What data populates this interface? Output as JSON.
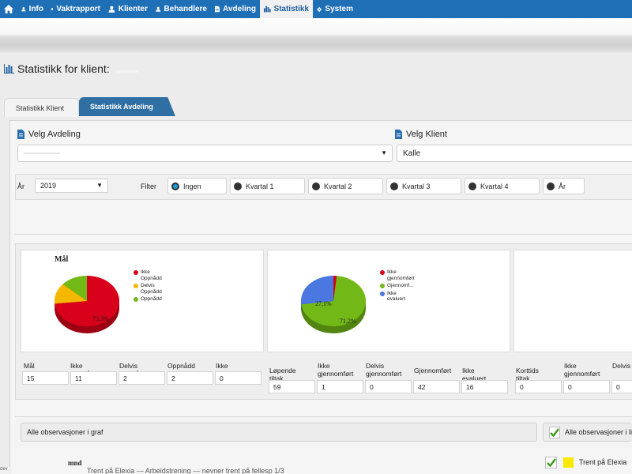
{
  "nav": {
    "items": [
      {
        "label": "Info",
        "icon": "user-icon"
      },
      {
        "label": "Vaktrapport",
        "icon": "document-icon"
      },
      {
        "label": "Klienter",
        "icon": "user-icon"
      },
      {
        "label": "Behandlere",
        "icon": "user-icon"
      },
      {
        "label": "Avdeling",
        "icon": "document-icon"
      },
      {
        "label": "Statistikk",
        "icon": "bar-chart-icon",
        "active": true
      },
      {
        "label": "System",
        "icon": "gear-icon"
      }
    ]
  },
  "page": {
    "title": "Statistikk for klient:"
  },
  "tabs": {
    "klient": "Statistikk Klient",
    "avdeling": "Statistikk Avdeling"
  },
  "selectors": {
    "avdeling_label": "Velg Avdeling",
    "avdeling_value": "",
    "klient_label": "Velg Klient",
    "klient_value": "Kalle"
  },
  "filter": {
    "year_label": "År",
    "year_value": "2019",
    "filter_label": "Filter",
    "options": [
      "Ingen",
      "Kvartal 1",
      "Kvartal 2",
      "Kvartal 3",
      "Kvartal 4",
      "År"
    ],
    "selected": "Ingen"
  },
  "chart_data": [
    {
      "type": "pie",
      "title": "Mål",
      "categories": [
        "Ikke Oppnådd",
        "Delvis Oppnådd",
        "Oppnådd"
      ],
      "values": [
        11,
        2,
        2
      ],
      "colors": [
        "#d9001b",
        "#f5b800",
        "#72b918"
      ],
      "labels": [
        "73,3%"
      ]
    },
    {
      "type": "pie",
      "title": "",
      "categories": [
        "Ikke gjennomført",
        "Gjennomf...",
        "Ikke evaluert"
      ],
      "values": [
        1,
        42,
        16
      ],
      "colors": [
        "#d9001b",
        "#72b918",
        "#4a78e0"
      ],
      "labels": [
        "71,2%",
        "27,1%"
      ]
    }
  ],
  "mal_fields": [
    {
      "label": "Mål",
      "value": "15"
    },
    {
      "label": "Ikke Oppnådd",
      "value": "11"
    },
    {
      "label": "Delvis Oppnådd",
      "value": "2"
    },
    {
      "label": "Oppnådd",
      "value": "2"
    },
    {
      "label": "Ikke evaluert",
      "value": "0"
    }
  ],
  "tiltak_fields": [
    {
      "label": "Løpende tiltak",
      "value": "59"
    },
    {
      "label": "Ikke gjennomført",
      "value": "1"
    },
    {
      "label": "Delvis gjennomført",
      "value": "0"
    },
    {
      "label": "Gjennomført",
      "value": "42"
    },
    {
      "label": "Ikke evaluert",
      "value": "16"
    }
  ],
  "kort_fields": [
    {
      "label": "Korttids tiltak",
      "value": "0"
    },
    {
      "label": "Ikke gjennomført",
      "value": "0"
    },
    {
      "label": "Delvis",
      "value": "0"
    }
  ],
  "observations": {
    "graph_button": "Alle observasjoner i graf",
    "list_button": "Alle observasjoner i liste",
    "month_label": "mnd",
    "legend_item": "Trent på Elexia",
    "legend_color": "#f7ea00",
    "cut_text": "Trent på Elexia — Arbeidstrening — nevner trent på fellesp 1/3"
  },
  "corner_text": "dev"
}
